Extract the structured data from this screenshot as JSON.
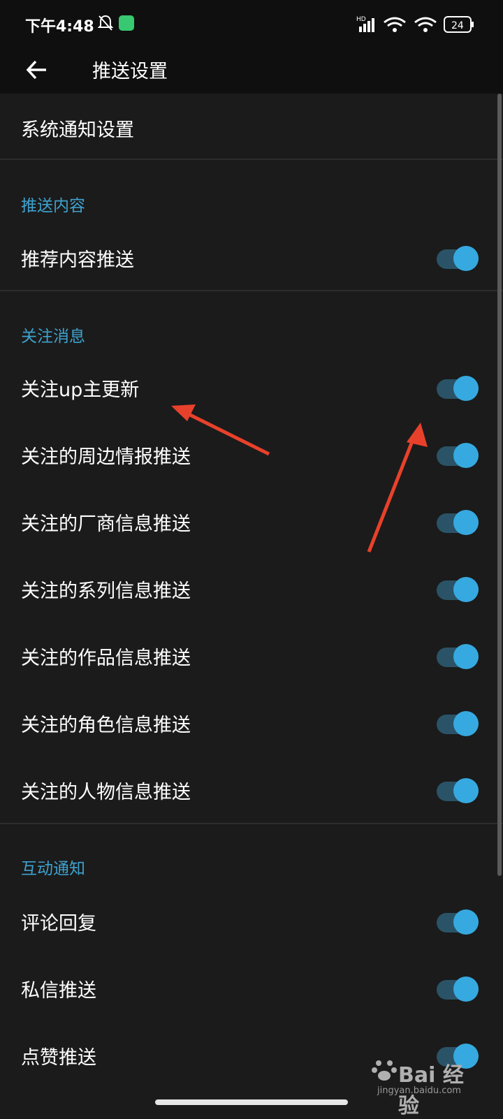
{
  "status": {
    "time": "下午4:48",
    "battery": "24",
    "signal_label": "HD"
  },
  "toolbar": {
    "title": "推送设置"
  },
  "system_notification": {
    "label": "系统通知设置"
  },
  "sections": [
    {
      "title": "推送内容",
      "items": [
        {
          "label": "推荐内容推送",
          "enabled": true
        }
      ]
    },
    {
      "title": "关注消息",
      "items": [
        {
          "label": "关注up主更新",
          "enabled": true
        },
        {
          "label": "关注的周边情报推送",
          "enabled": true
        },
        {
          "label": "关注的厂商信息推送",
          "enabled": true
        },
        {
          "label": "关注的系列信息推送",
          "enabled": true
        },
        {
          "label": "关注的作品信息推送",
          "enabled": true
        },
        {
          "label": "关注的角色信息推送",
          "enabled": true
        },
        {
          "label": "关注的人物信息推送",
          "enabled": true
        }
      ]
    },
    {
      "title": "互动通知",
      "items": [
        {
          "label": "评论回复",
          "enabled": true
        },
        {
          "label": "私信推送",
          "enabled": true
        },
        {
          "label": "点赞推送",
          "enabled": true
        }
      ]
    }
  ],
  "colors": {
    "accent": "#36a9e0",
    "section_title": "#3ea2cf",
    "background": "#1b1b1b",
    "annotation_arrow": "#e8412b"
  },
  "watermark": {
    "text": "Bai 经验",
    "sub": "jingyan.baidu.com"
  }
}
